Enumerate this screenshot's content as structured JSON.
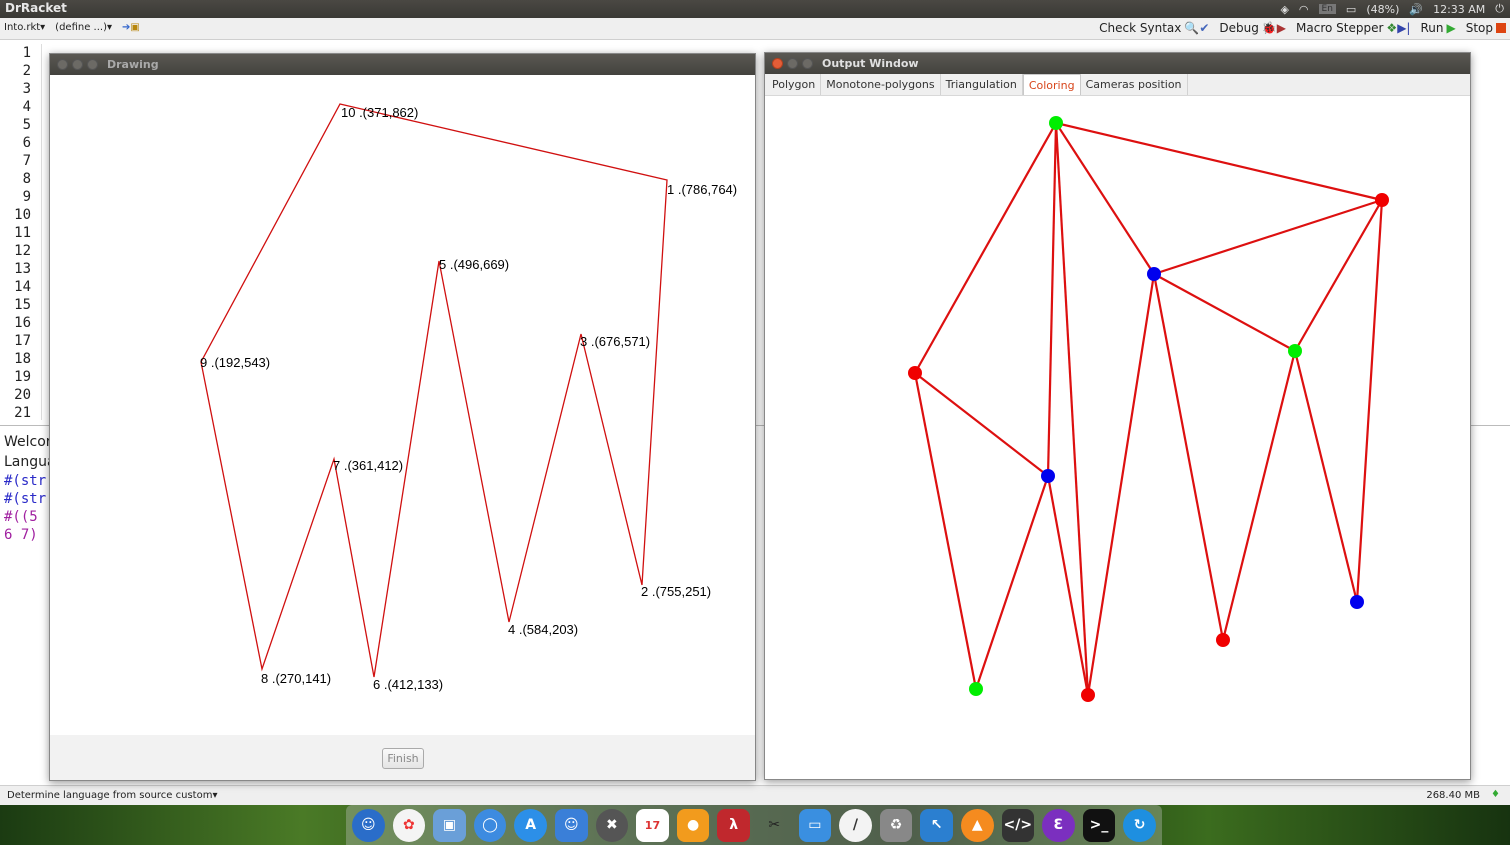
{
  "system_bar": {
    "app_name": "DrRacket",
    "battery": "(48%)",
    "keyboard": "En",
    "time": "12:33 AM"
  },
  "toolbar": {
    "file_menu": "Into.rkt▾",
    "define_menu": "(define ...)▾",
    "check_syntax": "Check Syntax",
    "debug": "Debug",
    "macro_stepper": "Macro Stepper",
    "run": "Run",
    "stop": "Stop"
  },
  "editor": {
    "line_numbers": [
      "1",
      "2",
      "3",
      "4",
      "5",
      "6",
      "7",
      "8",
      "9",
      "10",
      "11",
      "12",
      "13",
      "14",
      "15",
      "16",
      "17",
      "18",
      "19",
      "20",
      "21"
    ]
  },
  "repl": {
    "line1": "Welcor",
    "line2": "Langua",
    "line3": "#(str",
    "line4": "#(str",
    "line5": "#((5",
    "line6": "6 7)"
  },
  "status_bar": {
    "language": "Determine language from source custom▾",
    "memory": "268.40 MB"
  },
  "drawing_window": {
    "title": "Drawing",
    "finish_label": "Finish",
    "stroke_color": "#d01010",
    "vertices": [
      {
        "label": "10 .(371,862)"
      },
      {
        "label": "1 .(786,764)"
      },
      {
        "label": "5 .(496,669)"
      },
      {
        "label": "3 .(676,571)"
      },
      {
        "label": "9 .(192,543)"
      },
      {
        "label": "7 .(361,412)"
      },
      {
        "label": "2 .(755,251)"
      },
      {
        "label": "4 .(584,203)"
      },
      {
        "label": "8 .(270,141)"
      },
      {
        "label": "6 .(412,133)"
      }
    ]
  },
  "output_window": {
    "title": "Output Window",
    "tabs": [
      "Polygon",
      "Monotone-polygons",
      "Triangulation",
      "Coloring",
      "Cameras position"
    ],
    "active_tab": "Coloring",
    "colors": {
      "red": "#f00000",
      "green": "#00ee00",
      "blue": "#0000ee",
      "edge": "#dd1010"
    }
  }
}
